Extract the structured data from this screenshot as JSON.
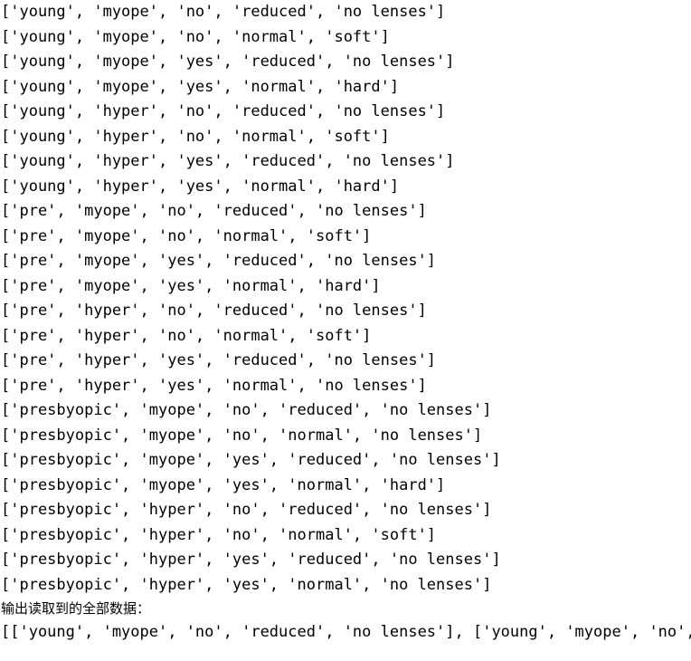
{
  "console": {
    "background_color": "#ffffff",
    "text_color": "#000000",
    "data_rows": [
      "['young', 'myope', 'no', 'reduced', 'no lenses']",
      "['young', 'myope', 'no', 'normal', 'soft']",
      "['young', 'myope', 'yes', 'reduced', 'no lenses']",
      "['young', 'myope', 'yes', 'normal', 'hard']",
      "['young', 'hyper', 'no', 'reduced', 'no lenses']",
      "['young', 'hyper', 'no', 'normal', 'soft']",
      "['young', 'hyper', 'yes', 'reduced', 'no lenses']",
      "['young', 'hyper', 'yes', 'normal', 'hard']",
      "['pre', 'myope', 'no', 'reduced', 'no lenses']",
      "['pre', 'myope', 'no', 'normal', 'soft']",
      "['pre', 'myope', 'yes', 'reduced', 'no lenses']",
      "['pre', 'myope', 'yes', 'normal', 'hard']",
      "['pre', 'hyper', 'no', 'reduced', 'no lenses']",
      "['pre', 'hyper', 'no', 'normal', 'soft']",
      "['pre', 'hyper', 'yes', 'reduced', 'no lenses']",
      "['pre', 'hyper', 'yes', 'normal', 'no lenses']",
      "['presbyopic', 'myope', 'no', 'reduced', 'no lenses']",
      "['presbyopic', 'myope', 'no', 'normal', 'no lenses']",
      "['presbyopic', 'myope', 'yes', 'reduced', 'no lenses']",
      "['presbyopic', 'myope', 'yes', 'normal', 'hard']",
      "['presbyopic', 'hyper', 'no', 'reduced', 'no lenses']",
      "['presbyopic', 'hyper', 'no', 'normal', 'soft']",
      "['presbyopic', 'hyper', 'yes', 'reduced', 'no lenses']",
      "['presbyopic', 'hyper', 'yes', 'normal', 'no lenses']"
    ],
    "section_label": "输出读取到的全部数据：",
    "final_line": "[['young', 'myope', 'no', 'reduced', 'no lenses'], ['young', 'myope', 'no',"
  }
}
